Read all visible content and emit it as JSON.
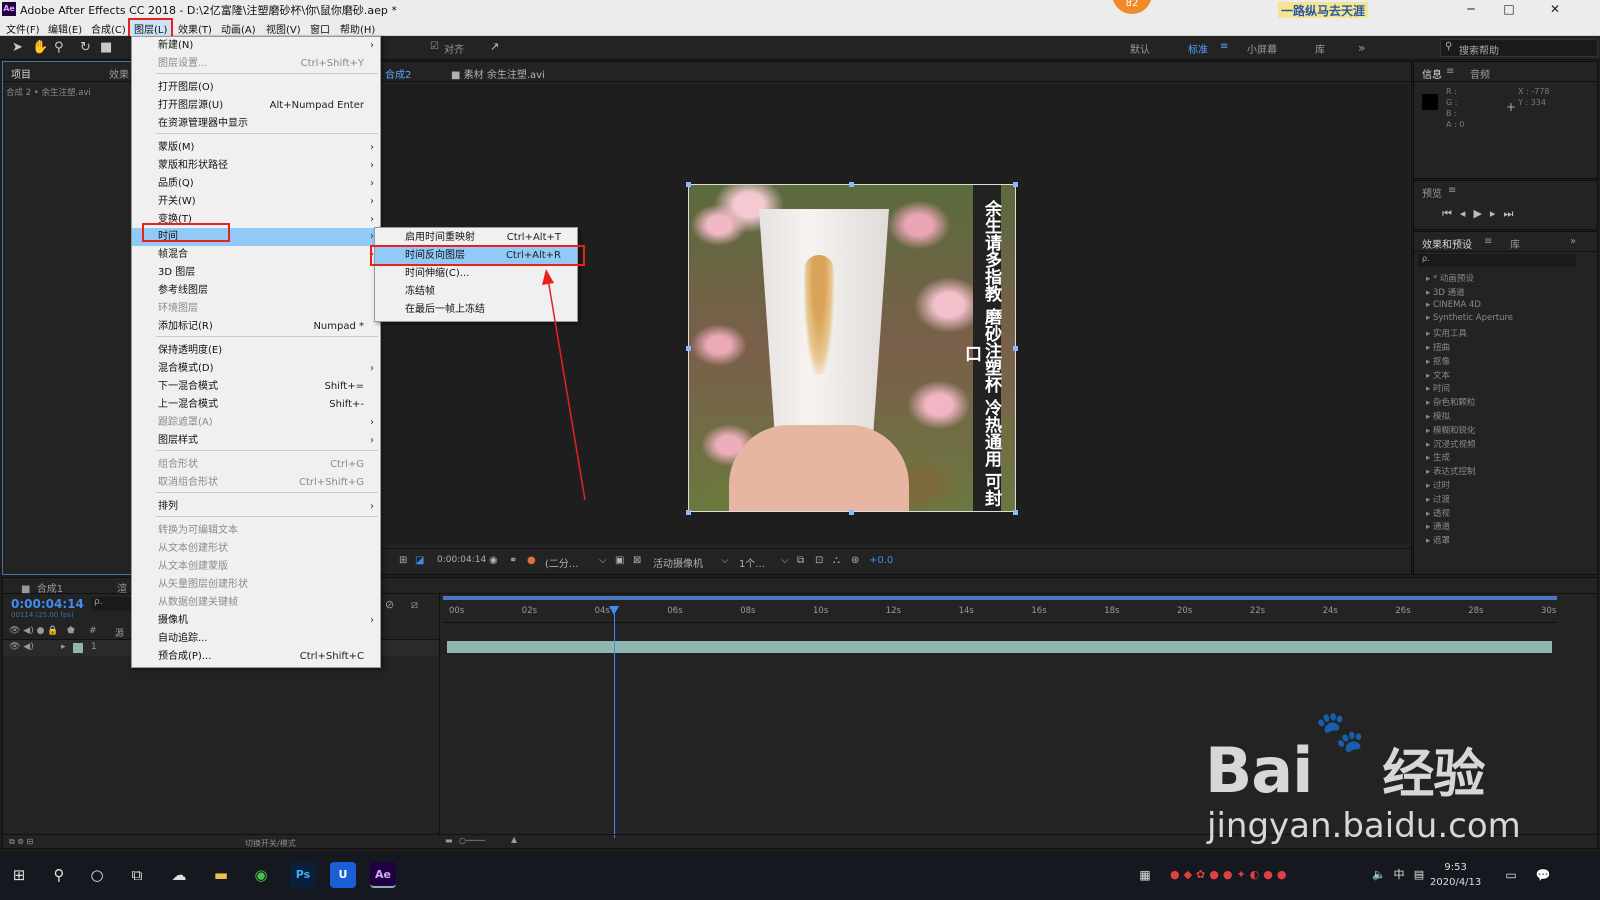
{
  "titlebar": {
    "title": "Adobe After Effects CC 2018 - D:\\2亿富隆\\注塑磨砂杯\\你\\鼠你磨砂.aep *",
    "badge": "82",
    "banner": "一路纵马去天涯",
    "minimize": "─",
    "maximize": "□",
    "close": "✕"
  },
  "menubar": {
    "items": [
      "文件(F)",
      "编辑(E)",
      "合成(C)",
      "图层(L)",
      "效果(T)",
      "动画(A)",
      "视图(V)",
      "窗口",
      "帮助(H)"
    ]
  },
  "toolbar": {
    "align_label": "对齐",
    "workspaces": [
      "默认",
      "标准",
      "小屏幕",
      "库"
    ],
    "search_placeholder": "搜索帮助"
  },
  "project": {
    "tabs": [
      "项目",
      "效果"
    ],
    "item": "合成 2 • 余生注塑.avi"
  },
  "comp": {
    "tab1": "合成2",
    "tab2": "素材 余生注塑.avi",
    "vertical_text": "余生请多指教 磨砂注塑杯 冷热通用 可封口",
    "bar": {
      "timecode": "0:00:04:14",
      "resolution": "(二分...",
      "camera": "活动摄像机",
      "views": "1个...",
      "offset": "+0.0"
    }
  },
  "info": {
    "tabs": [
      "信息",
      "音频"
    ],
    "r": "R :",
    "g": "G :",
    "b": "B :",
    "a": "A : 0",
    "x": "X : -778",
    "y": "Y : 334"
  },
  "preview": {
    "title": "预览"
  },
  "effects": {
    "tabs": [
      "效果和预设",
      "库"
    ],
    "search_placeholder": "ρ.",
    "items": [
      "* 动画预设",
      "3D 通道",
      "CINEMA 4D",
      "Synthetic Aperture",
      "实用工具",
      "扭曲",
      "抠像",
      "文本",
      "时间",
      "杂色和颗粒",
      "模拟",
      "模糊和锐化",
      "沉浸式视频",
      "生成",
      "表达式控制",
      "过时",
      "过渡",
      "透视",
      "通道",
      "遮罩"
    ]
  },
  "timeline": {
    "tabs": [
      "合成1",
      "渲"
    ],
    "timecode": "0:00:04:14",
    "timecode_sub": "00114 (25.00 fps)",
    "col_label": "源",
    "layer_num": "1",
    "ticks": [
      "00s",
      "02s",
      "04s",
      "06s",
      "08s",
      "10s",
      "12s",
      "14s",
      "16s",
      "18s",
      "20s",
      "22s",
      "24s",
      "26s",
      "28s",
      "30s"
    ],
    "footer_label": "切换开关/模式"
  },
  "layer_menu": {
    "items": [
      {
        "label": "新建(N)",
        "shortcut": "",
        "arrow": true,
        "disabled": false
      },
      {
        "label": "图层设置...",
        "shortcut": "Ctrl+Shift+Y",
        "arrow": false,
        "disabled": true
      },
      {
        "label": "打开图层(O)",
        "shortcut": "",
        "arrow": false,
        "disabled": false
      },
      {
        "label": "打开图层源(U)",
        "shortcut": "Alt+Numpad Enter",
        "arrow": false,
        "disabled": false
      },
      {
        "label": "在资源管理器中显示",
        "shortcut": "",
        "arrow": false,
        "disabled": false
      },
      {
        "label": "蒙版(M)",
        "shortcut": "",
        "arrow": true,
        "disabled": false
      },
      {
        "label": "蒙版和形状路径",
        "shortcut": "",
        "arrow": true,
        "disabled": false
      },
      {
        "label": "品质(Q)",
        "shortcut": "",
        "arrow": true,
        "disabled": false
      },
      {
        "label": "开关(W)",
        "shortcut": "",
        "arrow": true,
        "disabled": false
      },
      {
        "label": "变换(T)",
        "shortcut": "",
        "arrow": true,
        "disabled": false
      },
      {
        "label": "时间",
        "shortcut": "",
        "arrow": true,
        "disabled": false
      },
      {
        "label": "帧混合",
        "shortcut": "",
        "arrow": true,
        "disabled": false
      },
      {
        "label": "3D 图层",
        "shortcut": "",
        "arrow": false,
        "disabled": false
      },
      {
        "label": "参考线图层",
        "shortcut": "",
        "arrow": false,
        "disabled": false
      },
      {
        "label": "环境图层",
        "shortcut": "",
        "arrow": false,
        "disabled": true
      },
      {
        "label": "添加标记(R)",
        "shortcut": "Numpad *",
        "arrow": false,
        "disabled": false
      },
      {
        "label": "保持透明度(E)",
        "shortcut": "",
        "arrow": false,
        "disabled": false
      },
      {
        "label": "混合模式(D)",
        "shortcut": "",
        "arrow": true,
        "disabled": false
      },
      {
        "label": "下一混合模式",
        "shortcut": "Shift+=",
        "arrow": false,
        "disabled": false
      },
      {
        "label": "上一混合模式",
        "shortcut": "Shift+-",
        "arrow": false,
        "disabled": false
      },
      {
        "label": "跟踪遮罩(A)",
        "shortcut": "",
        "arrow": true,
        "disabled": true
      },
      {
        "label": "图层样式",
        "shortcut": "",
        "arrow": true,
        "disabled": false
      },
      {
        "label": "组合形状",
        "shortcut": "Ctrl+G",
        "arrow": false,
        "disabled": true
      },
      {
        "label": "取消组合形状",
        "shortcut": "Ctrl+Shift+G",
        "arrow": false,
        "disabled": true
      },
      {
        "label": "排列",
        "shortcut": "",
        "arrow": true,
        "disabled": false
      },
      {
        "label": "转换为可编辑文本",
        "shortcut": "",
        "arrow": false,
        "disabled": true
      },
      {
        "label": "从文本创建形状",
        "shortcut": "",
        "arrow": false,
        "disabled": true
      },
      {
        "label": "从文本创建蒙版",
        "shortcut": "",
        "arrow": false,
        "disabled": true
      },
      {
        "label": "从矢量图层创建形状",
        "shortcut": "",
        "arrow": false,
        "disabled": true
      },
      {
        "label": "从数据创建关键帧",
        "shortcut": "",
        "arrow": false,
        "disabled": true
      },
      {
        "label": "摄像机",
        "shortcut": "",
        "arrow": true,
        "disabled": false
      },
      {
        "label": "自动追踪...",
        "shortcut": "",
        "arrow": false,
        "disabled": false
      },
      {
        "label": "预合成(P)...",
        "shortcut": "Ctrl+Shift+C",
        "arrow": false,
        "disabled": false
      }
    ]
  },
  "time_submenu": {
    "items": [
      {
        "label": "启用时间重映射",
        "shortcut": "Ctrl+Alt+T"
      },
      {
        "label": "时间反向图层",
        "shortcut": "Ctrl+Alt+R"
      },
      {
        "label": "时间伸缩(C)...",
        "shortcut": ""
      },
      {
        "label": "冻结帧",
        "shortcut": ""
      },
      {
        "label": "在最后一帧上冻结",
        "shortcut": ""
      }
    ]
  },
  "taskbar": {
    "time": "9:53",
    "date": "2020/4/13",
    "ime": "中",
    "apps": [
      "Ps",
      "U",
      "Ae"
    ]
  },
  "watermark": {
    "brand": "Bai",
    "brand2": "经验",
    "site": "jingyan.baidu.com"
  },
  "colors": {
    "accent": "#3f8df0",
    "highlight": "#91c9f7",
    "annotation": "#e8221b"
  }
}
